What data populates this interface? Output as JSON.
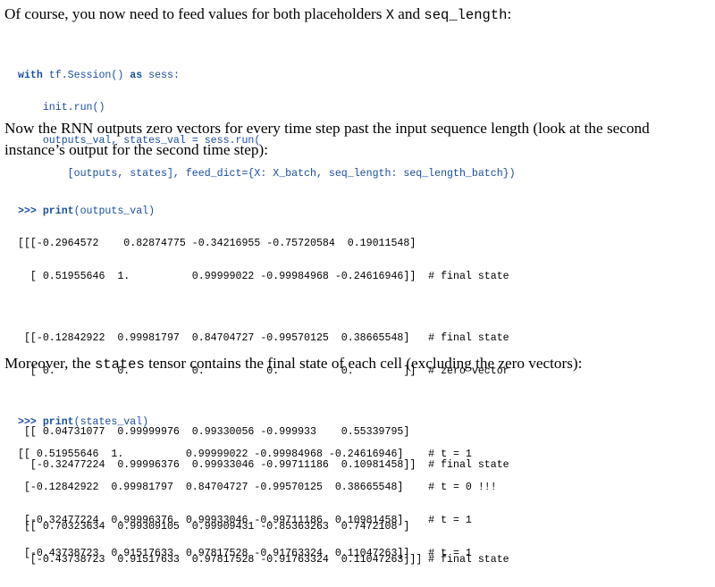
{
  "para1": {
    "text_before": "Of course, you now need to feed values for both placeholders ",
    "code_X": "X",
    "text_and": " and ",
    "code_seq": "seq_length",
    "text_after": ":"
  },
  "code1": {
    "line1_kw1": "with",
    "line1_mid": " tf.Session() ",
    "line1_kw2": "as",
    "line1_end": " sess:",
    "line2": "    init.run()",
    "line3": "    outputs_val, states_val = sess.run(",
    "line4": "        [outputs, states], feed_dict={X: X_batch, seq_length: seq_length_batch})"
  },
  "para2": {
    "line1": "Now the RNN outputs zero vectors for every time step past the input sequence length (look at the second",
    "line2": "instance’s output for the second time step):"
  },
  "code2": {
    "prompt": ">>>",
    "fn": "print",
    "arg": "(outputs_val)",
    "rows": [
      "[[[-0.2964572    0.82874775 -0.34216955 -0.75720584  0.19011548]",
      "  [ 0.51955646  1.          0.99999022 -0.99984968 -0.24616946]]  # final state",
      "",
      " [[-0.12842922  0.99981797  0.84704727 -0.99570125  0.38665548]   # final state",
      "  [ 0.          0.          0.          0.          0.        ]]  # zero vector",
      "",
      " [[ 0.04731077  0.99999976  0.99330056 -0.999933    0.55339795]",
      "  [-0.32477224  0.99996376  0.99933046 -0.99711186  0.10981458]]  # final state",
      "",
      " [[ 0.70323634  0.99309105  0.99909431 -0.85363263  0.7472108 ]",
      "  [-0.43738723  0.91517633  0.97817528 -0.91763324  0.11047263]]] # final state"
    ]
  },
  "para3": {
    "text_before": "Moreover, the ",
    "code_states": "states",
    "text_after": " tensor contains the final state of each cell (excluding the zero vectors):"
  },
  "code3": {
    "prompt": ">>>",
    "fn": "print",
    "arg": "(states_val)",
    "rows": [
      "[[ 0.51955646  1.          0.99999022 -0.99984968 -0.24616946]    # t = 1",
      " [-0.12842922  0.99981797  0.84704727 -0.99570125  0.38665548]    # t = 0 !!!",
      " [-0.32477224  0.99996376  0.99933046 -0.99711186  0.10981458]    # t = 1",
      " [-0.43738723  0.91517633  0.97817528 -0.91763324  0.11047263]]   # t = 1"
    ]
  }
}
